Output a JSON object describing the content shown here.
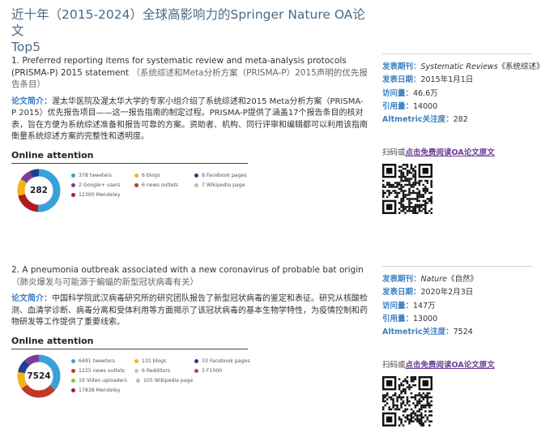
{
  "page": {
    "title_line1": "近十年（2015-2024）全球高影响力的Springer Nature OA论文",
    "title_line2": "Top5"
  },
  "labels": {
    "summary": "论文简介：",
    "journal": "发表期刊：",
    "date": "发表日期：",
    "visits": "访问量：",
    "citations": "引用量：",
    "altmetric": "Altmetric关注度：",
    "scan_prefix": "扫码或",
    "scan_link": "点击免费阅读OA论文原文",
    "online_attention": "Online attention"
  },
  "articles": [
    {
      "title": "1. Preferred reporting items for systematic review and meta-analysis protocols (PRISMA-P) 2015 statement",
      "title_zh": "（系统综述和Meta分析方案（PRISMA-P）2015声明的优先报告条目）",
      "summary": "渥太华医院及渥太华大学的专家小组介绍了系统综述和2015 Meta分析方案（PRISMA-P 2015）优先报告项目——这一报告指南的制定过程。PRISMA-P提供了涵盖17个报告条目的核对表，旨在方便为系统综述准备和报告可靠的方案。资助者、机构、同行评审和编辑都可以利用该指南衡量系统综述方案的完整性和透明度。",
      "journal": "Systematic Reviews",
      "journal_zh": "《系统综述》",
      "date": "2015年1月1日",
      "visits": "46.6万",
      "citations": "14000",
      "altmetric": "282",
      "attention_score": "282",
      "legend_rows": [
        [
          {
            "text": "378 tweeters",
            "color": "#3aa0d8"
          },
          {
            "text": "6 blogs",
            "color": "#f2b21b"
          },
          {
            "text": "8 Facebook pages",
            "color": "#1f3f8f"
          }
        ],
        [
          {
            "text": "2 Google+ users",
            "color": "#7d3c98"
          },
          {
            "text": "6 news outlets",
            "color": "#c0392b"
          },
          {
            "text": "7 Wikipedia page",
            "color": "#bbbbbb"
          }
        ],
        [
          {
            "text": "12300 Mendeley",
            "color": "#b01c1c"
          }
        ]
      ]
    },
    {
      "title": "2. A pneumonia outbreak associated with a new coronavirus of probable bat origin",
      "title_zh": "（肺炎爆发与可能源于蝙蝠的新型冠状病毒有关）",
      "summary": "中国科学院武汉病毒研究所的研究团队报告了新型冠状病毒的鉴定和表征。研究从核酸检测、血清学诊断、病毒分离和受体利用等方面揭示了该冠状病毒的基本生物学特性，为疫情控制和药物研发等工作提供了重要线索。",
      "journal": "Nature",
      "journal_zh": "《自然》",
      "date": "2020年2月3日",
      "visits": "147万",
      "citations": "13000",
      "altmetric": "7524",
      "attention_score": "7524",
      "legend_rows": [
        [
          {
            "text": "6491 tweeters",
            "color": "#3aa0d8"
          },
          {
            "text": "131 blogs",
            "color": "#f2b21b"
          },
          {
            "text": "33 Facebook pages",
            "color": "#1f3f8f"
          }
        ],
        [
          {
            "text": "1225 news outlets",
            "color": "#c0392b"
          },
          {
            "text": "6 Redditors",
            "color": "#9ed0e6"
          },
          {
            "text": "3 F1000",
            "color": "#d04040"
          }
        ],
        [
          {
            "text": "19 Video uploaders",
            "color": "#8bc34a"
          },
          {
            "text": "105 Wikipedia page",
            "color": "#bbbbbb"
          }
        ],
        [
          {
            "text": "17838 Mendeley",
            "color": "#b01c1c"
          }
        ]
      ]
    }
  ],
  "colors": {
    "accent": "#3a7fc1",
    "title": "#4a6a86",
    "link": "#6a3f93"
  },
  "icons": [
    "altmetric-donut-icon",
    "qr-code-icon"
  ]
}
